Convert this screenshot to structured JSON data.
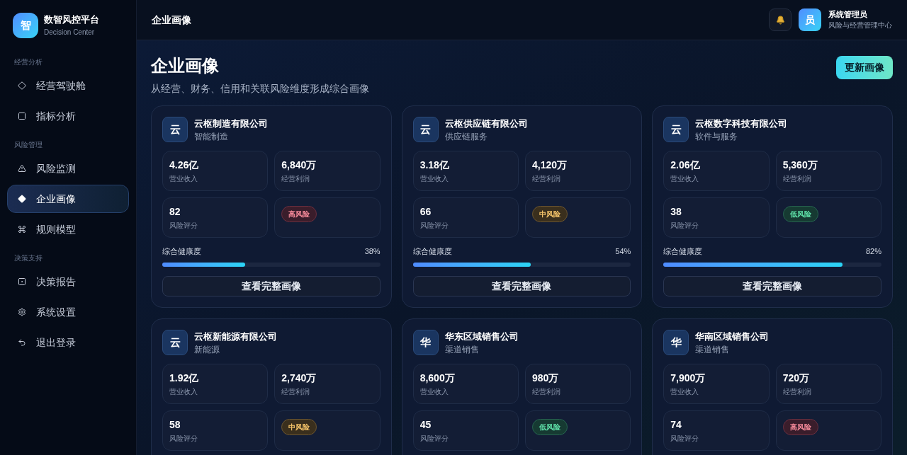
{
  "brand": {
    "logo": "智",
    "name": "数智风控平台",
    "subtitle": "Decision Center"
  },
  "sidebar": {
    "groups": [
      {
        "label": "经营分析",
        "items": [
          {
            "label": "经营驾驶舱",
            "selected": false
          },
          {
            "label": "指标分析",
            "selected": false
          }
        ]
      },
      {
        "label": "风险管理",
        "items": [
          {
            "label": "风险监测",
            "selected": false
          },
          {
            "label": "企业画像",
            "selected": true
          },
          {
            "label": "规则模型",
            "selected": false
          }
        ]
      },
      {
        "label": "决策支持",
        "items": [
          {
            "label": "决策报告",
            "selected": false
          },
          {
            "label": "系统设置",
            "selected": false
          },
          {
            "label": "退出登录",
            "selected": false
          }
        ]
      }
    ]
  },
  "header": {
    "title": "企业画像",
    "user": {
      "avatar": "员",
      "name": "系统管理员",
      "role": "风险与经营管理中心"
    }
  },
  "page": {
    "title": "企业画像",
    "subtitle": "从经营、财务、信用和关联风险维度形成综合画像",
    "action": "更新画像"
  },
  "companies": [
    {
      "avatar": "云",
      "name": "云枢制造有限公司",
      "industry": "智能制造",
      "revenue": "4.26亿",
      "revenue_label": "营业收入",
      "profit": "6,840万",
      "profit_label": "经营利润",
      "score": "82",
      "score_label": "风险评分",
      "risk": {
        "label": "高风险",
        "kind": "high"
      },
      "health_label": "综合健康度",
      "health_reading": "38%",
      "level": 0.38,
      "button": "查看完整画像"
    },
    {
      "avatar": "云",
      "name": "云枢供应链有限公司",
      "industry": "供应链服务",
      "revenue": "3.18亿",
      "revenue_label": "营业收入",
      "profit": "4,120万",
      "profit_label": "经营利润",
      "score": "66",
      "score_label": "风险评分",
      "risk": {
        "label": "中风险",
        "kind": "medium"
      },
      "health_label": "综合健康度",
      "health_reading": "54%",
      "level": 0.54,
      "button": "查看完整画像"
    },
    {
      "avatar": "云",
      "name": "云枢数字科技有限公司",
      "industry": "软件与服务",
      "revenue": "2.06亿",
      "revenue_label": "营业收入",
      "profit": "5,360万",
      "profit_label": "经营利润",
      "score": "38",
      "score_label": "风险评分",
      "risk": {
        "label": "低风险",
        "kind": "low"
      },
      "health_label": "综合健康度",
      "health_reading": "82%",
      "level": 0.82,
      "button": "查看完整画像"
    },
    {
      "avatar": "云",
      "name": "云枢新能源有限公司",
      "industry": "新能源",
      "revenue": "1.92亿",
      "revenue_label": "营业收入",
      "profit": "2,740万",
      "profit_label": "经营利润",
      "score": "58",
      "score_label": "风险评分",
      "risk": {
        "label": "中风险",
        "kind": "medium"
      }
    },
    {
      "avatar": "华",
      "name": "华东区域销售公司",
      "industry": "渠道销售",
      "revenue": "8,600万",
      "revenue_label": "营业收入",
      "profit": "980万",
      "profit_label": "经营利润",
      "score": "45",
      "score_label": "风险评分",
      "risk": {
        "label": "低风险",
        "kind": "low"
      }
    },
    {
      "avatar": "华",
      "name": "华南区域销售公司",
      "industry": "渠道销售",
      "revenue": "7,900万",
      "revenue_label": "营业收入",
      "profit": "720万",
      "profit_label": "经营利润",
      "score": "74",
      "score_label": "风险评分",
      "risk": {
        "label": "高风险",
        "kind": "high"
      }
    }
  ]
}
